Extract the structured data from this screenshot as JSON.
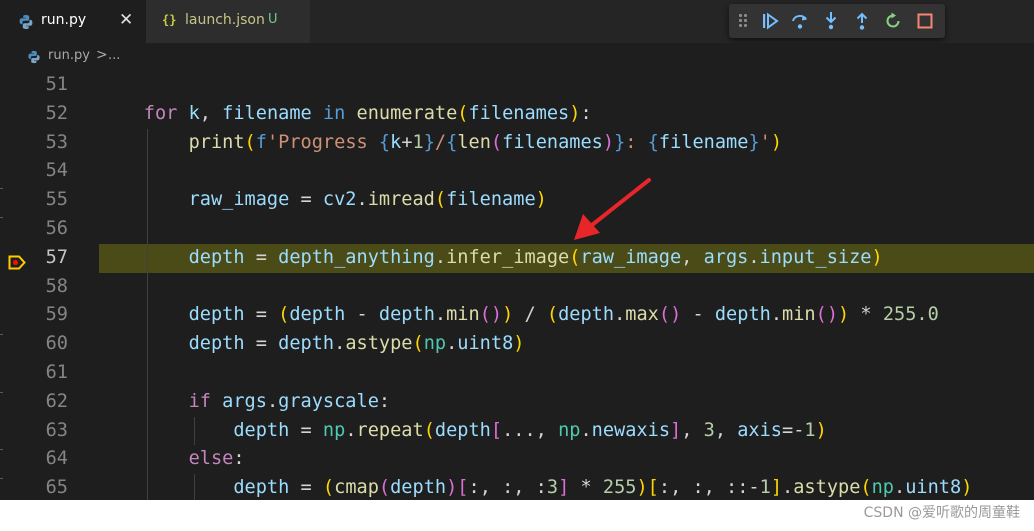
{
  "tabs": [
    {
      "label": "run.py",
      "active": true,
      "close": "✕"
    },
    {
      "label": "launch.json",
      "active": false,
      "badge": "U"
    }
  ],
  "breadcrumb": {
    "file": "run.py",
    "separator": ">",
    "more": "..."
  },
  "debug_toolbar": {
    "buttons": [
      "continue",
      "step-over",
      "step-into",
      "step-out",
      "restart",
      "stop"
    ]
  },
  "editor": {
    "lines": [
      {
        "n": "51"
      },
      {
        "n": "52"
      },
      {
        "n": "53"
      },
      {
        "n": "54"
      },
      {
        "n": "55"
      },
      {
        "n": "56"
      },
      {
        "n": "57"
      },
      {
        "n": "58"
      },
      {
        "n": "59"
      },
      {
        "n": "60"
      },
      {
        "n": "61"
      },
      {
        "n": "62"
      },
      {
        "n": "63"
      },
      {
        "n": "64"
      },
      {
        "n": "65"
      }
    ],
    "current_line": "57",
    "highlight_color": "#4b4b18"
  },
  "watermark": "CSDN @爱听歌的周童鞋"
}
